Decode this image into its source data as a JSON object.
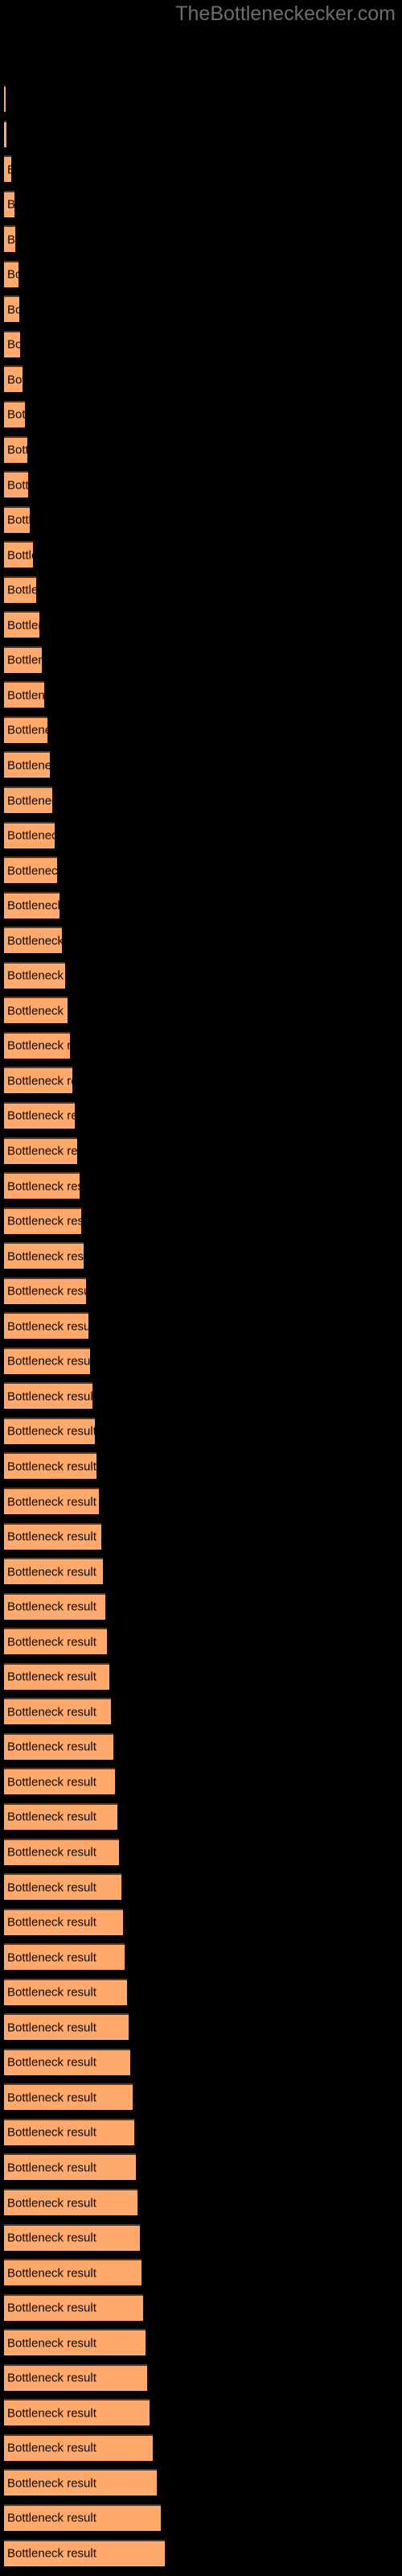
{
  "site": {
    "watermark": "TheBottleneckecker.com"
  },
  "chart_data": {
    "type": "bar",
    "orientation": "horizontal",
    "title": "",
    "subtitle": "",
    "xlabel": "",
    "ylabel": "",
    "grid": false,
    "legend": null,
    "background_color": "#000000",
    "bar_color": "#ffa96d",
    "bar_border_color": "#5c3a22",
    "label_color": "#0a0a0a",
    "watermark_color": "#6e6e6e",
    "bar_label_text": "Bottleneck result",
    "x_axis_ticks": [],
    "categories": [],
    "values": [
      2,
      3,
      9,
      13,
      14,
      18,
      19,
      20,
      23,
      26,
      29,
      30,
      32,
      36,
      40,
      44,
      47,
      50,
      54,
      57,
      60,
      63,
      66,
      69,
      72,
      76,
      79,
      82,
      85,
      88,
      91,
      94,
      96,
      99,
      102,
      105,
      107,
      110,
      113,
      115,
      118,
      121,
      123,
      126,
      128,
      131,
      133,
      136,
      138,
      141,
      143,
      146,
      148,
      150,
      153,
      155,
      157,
      160,
      162,
      164,
      166,
      169,
      171,
      173,
      176,
      178,
      181,
      185,
      190,
      195,
      200
    ],
    "xlim": [
      0,
      200
    ],
    "bar_count": 71
  }
}
